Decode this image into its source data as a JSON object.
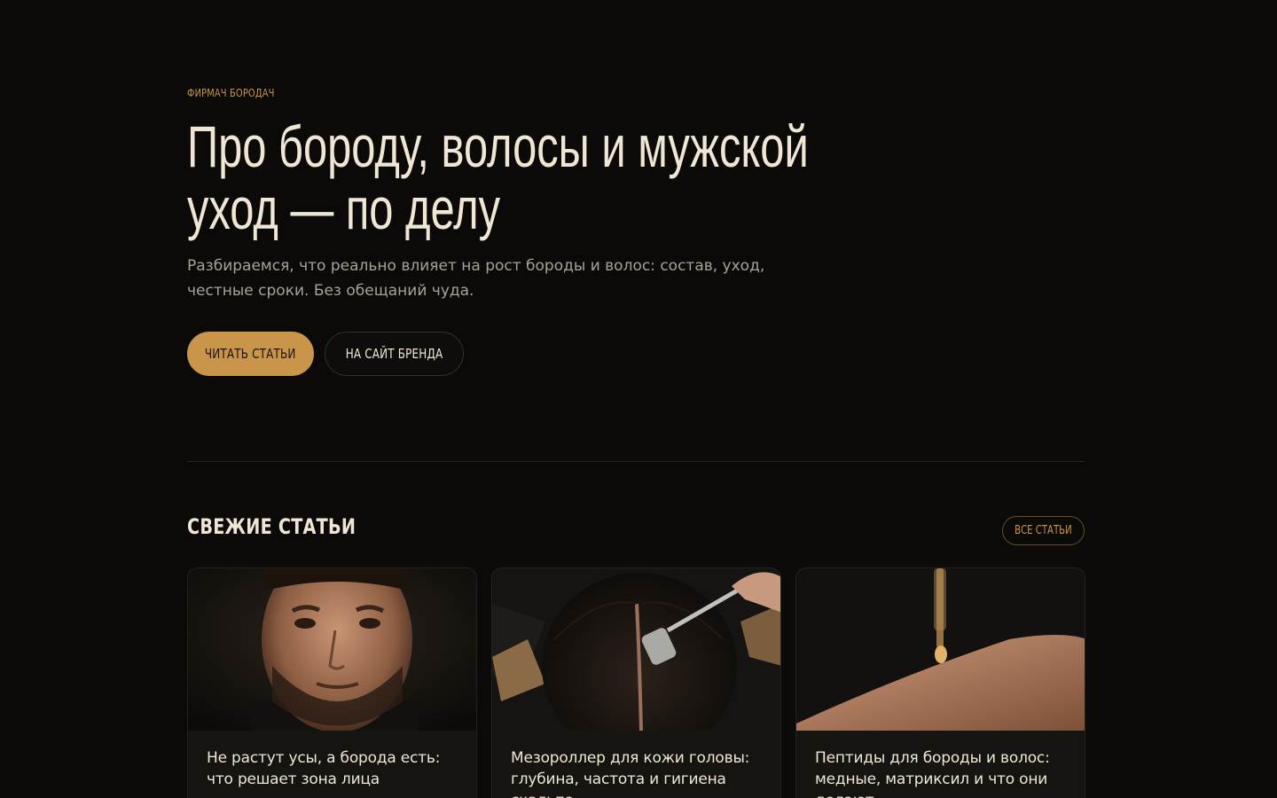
{
  "brand": "ФИРМАЧ БОРОДАЧ",
  "hero": {
    "title_line1": "Про бороду, волосы и мужской",
    "title_line2": "уход — по делу",
    "subtitle_line1": "Разбираемся, что реально влияет на рост бороды и волос: состав, уход,",
    "subtitle_line2": "честные сроки. Без обещаний чуда.",
    "primary_button": "ЧИТАТЬ СТАТЬИ",
    "secondary_button": "НА САЙТ БРЕНДА"
  },
  "section": {
    "title": "СВЕЖИЕ СТАТЬИ",
    "all_button": "ВСЕ СТАТЬИ"
  },
  "articles": [
    {
      "title": "Не растут усы, а борода есть: что решает зона лица",
      "image": "bearded-man-portrait"
    },
    {
      "title": "Мезороллер для кожи головы: глубина, частота и гигиена скальпа",
      "image": "dermaroller-on-scalp"
    },
    {
      "title": "Пептиды для бороды и волос: медные, матриксил и что они делают",
      "image": "serum-dropper-on-skin"
    }
  ],
  "colors": {
    "accent": "#c9954a",
    "background": "#0b0a09",
    "text": "#efe6d6",
    "muted": "#a9a196"
  }
}
